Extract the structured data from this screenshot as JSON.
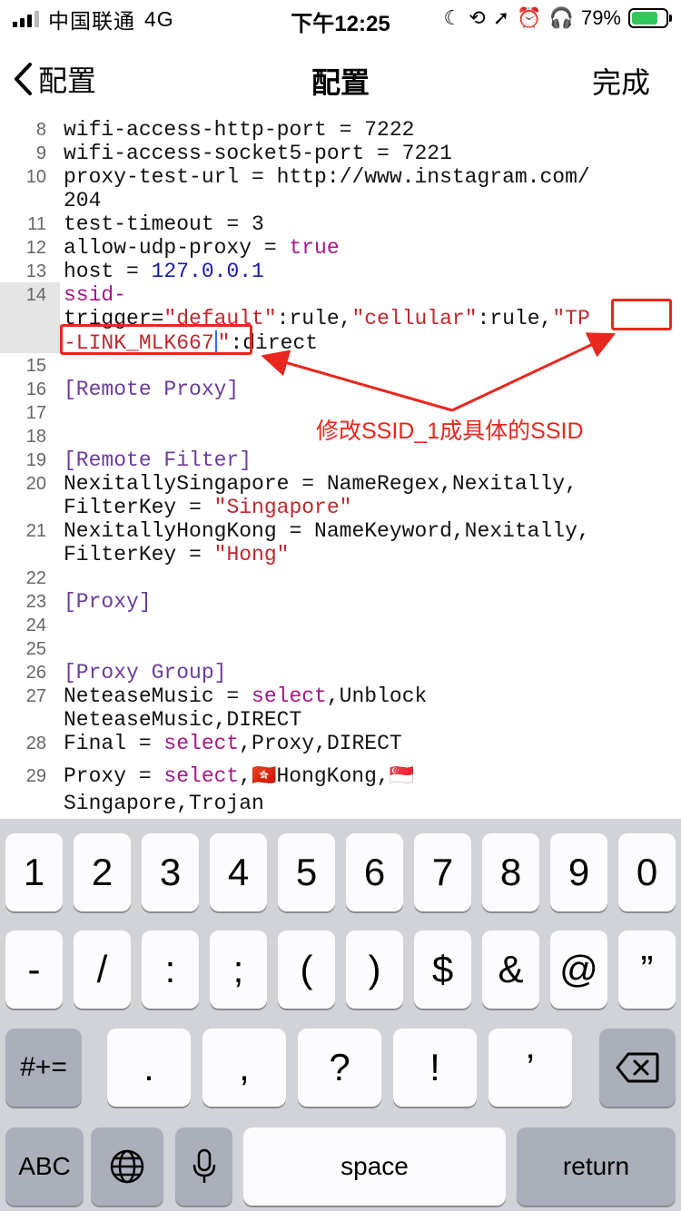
{
  "status_bar": {
    "carrier": "中国联通",
    "network": "4G",
    "time": "下午12:25",
    "battery_percent": "79%",
    "battery_level": 0.79,
    "icons": [
      "moon-icon",
      "orientation-lock-icon",
      "location-arrow-icon",
      "alarm-icon",
      "headphones-icon",
      "battery-charging-icon"
    ]
  },
  "nav": {
    "back_label": "配置",
    "title": "配置",
    "done_label": "完成"
  },
  "editor": {
    "line_numbers": [
      "8",
      "9",
      "10",
      "11",
      "12",
      "13",
      "14",
      "15",
      "16",
      "17",
      "18",
      "19",
      "20",
      "21",
      "22",
      "23",
      "24",
      "25",
      "26",
      "27",
      "28",
      "29"
    ],
    "l8": "wifi-access-http-port = 7222",
    "l9": "wifi-access-socket5-port = 7221",
    "l10a": "proxy-test-url = http://www.instagram.com/",
    "l10b": "204",
    "l11": "test-timeout = 3",
    "l12_key": "allow-udp-proxy = ",
    "l12_val": "true",
    "l13_key": "host = ",
    "l13_val": "127.0.0.1",
    "l14a": "ssid-",
    "l14b_1": "trigger=",
    "l14b_2": "\"default\"",
    "l14b_3": ":rule,",
    "l14b_4": "\"cellular\"",
    "l14b_5": ":rule,",
    "l14b_6": "\"TP",
    "l14c_1": "-LINK_MLK667",
    "l14c_2": "\"",
    "l14c_3": ":direct",
    "l16": "[Remote Proxy]",
    "l19": "[Remote Filter]",
    "l20a": "NexitallySingapore = NameRegex,Nexitally,",
    "l20b_key": "FilterKey = ",
    "l20b_val": "\"Singapore\"",
    "l21a": "NexitallyHongKong = NameKeyword,Nexitally,",
    "l21b_key": "FilterKey = ",
    "l21b_val": "\"Hong\"",
    "l23": "[Proxy]",
    "l26": "[Proxy Group]",
    "l27a_key": "NeteaseMusic = ",
    "l27a_kw": "select",
    "l27a_rest": ",Unblock",
    "l27b": "NeteaseMusic,DIRECT",
    "l28_key": "Final = ",
    "l28_kw": "select",
    "l28_rest": ",Proxy,DIRECT",
    "l29a_key": "Proxy = ",
    "l29a_kw": "select",
    "l29a_sep": ",",
    "l29a_flag1": "🇭🇰",
    "l29a_mid": "HongKong,",
    "l29a_flag2": "🇸🇬",
    "l29b": "Singapore,Trojan"
  },
  "annotation": {
    "text": "修改SSID_1成具体的SSID",
    "color": "#e8271e"
  },
  "keyboard": {
    "row1": [
      "1",
      "2",
      "3",
      "4",
      "5",
      "6",
      "7",
      "8",
      "9",
      "0"
    ],
    "row2": [
      "-",
      "/",
      ":",
      ";",
      "(",
      ")",
      "$",
      "&",
      "@",
      "”"
    ],
    "row3": [
      "#+=",
      ".",
      ",",
      "?",
      "!",
      "’"
    ],
    "row4": [
      "ABC",
      "space",
      "return"
    ],
    "icons": [
      "globe-icon",
      "microphone-icon",
      "backspace-icon"
    ]
  }
}
